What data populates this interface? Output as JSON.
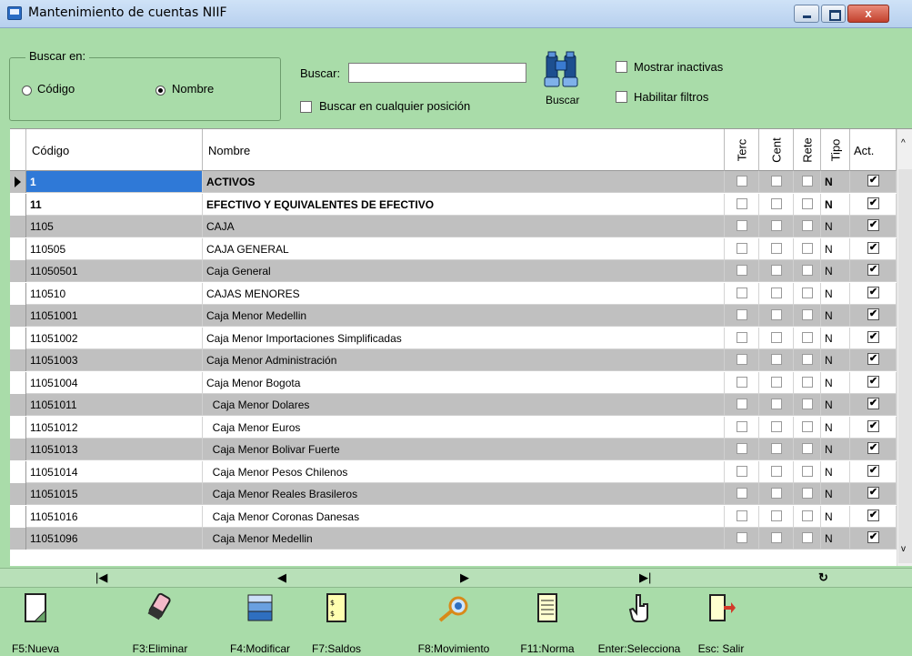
{
  "window": {
    "title": "Mantenimiento de cuentas NIIF",
    "close_label": "x"
  },
  "search": {
    "group_title": "Buscar en:",
    "radio_code": "Código",
    "radio_name": "Nombre",
    "selected": "Nombre",
    "label": "Buscar:",
    "value": "",
    "any_position_label": "Buscar en cualquier posición",
    "button_label": "Buscar",
    "show_inactive_label": "Mostrar inactivas",
    "enable_filters_label": "Habilitar filtros"
  },
  "grid": {
    "columns": {
      "code": "Código",
      "name": "Nombre",
      "terc": "Terc",
      "cent": "Cent",
      "rete": "Rete",
      "tipo": "Tipo",
      "act": "Act."
    },
    "rows": [
      {
        "code": "1",
        "name": "ACTIVOS",
        "tipo": "N",
        "act": true,
        "bold": true
      },
      {
        "code": "11",
        "name": "EFECTIVO Y EQUIVALENTES DE EFECTIVO",
        "tipo": "N",
        "act": true,
        "bold": true
      },
      {
        "code": "1105",
        "name": "CAJA",
        "tipo": "N",
        "act": true
      },
      {
        "code": "110505",
        "name": "CAJA GENERAL",
        "tipo": "N",
        "act": true
      },
      {
        "code": "11050501",
        "name": "Caja General",
        "tipo": "N",
        "act": true
      },
      {
        "code": "110510",
        "name": "CAJAS MENORES",
        "tipo": "N",
        "act": true
      },
      {
        "code": "11051001",
        "name": "Caja Menor Medellin",
        "tipo": "N",
        "act": true
      },
      {
        "code": "11051002",
        "name": "Caja Menor Importaciones Simplificadas",
        "tipo": "N",
        "act": true
      },
      {
        "code": "11051003",
        "name": "Caja Menor Administración",
        "tipo": "N",
        "act": true
      },
      {
        "code": "11051004",
        "name": "Caja Menor Bogota",
        "tipo": "N",
        "act": true
      },
      {
        "code": "11051011",
        "name": "  Caja Menor Dolares",
        "tipo": "N",
        "act": true
      },
      {
        "code": "11051012",
        "name": "  Caja Menor Euros",
        "tipo": "N",
        "act": true
      },
      {
        "code": "11051013",
        "name": "  Caja Menor Bolivar Fuerte",
        "tipo": "N",
        "act": true
      },
      {
        "code": "11051014",
        "name": "  Caja Menor Pesos Chilenos",
        "tipo": "N",
        "act": true
      },
      {
        "code": "11051015",
        "name": "  Caja Menor Reales Brasileros",
        "tipo": "N",
        "act": true
      },
      {
        "code": "11051016",
        "name": "  Caja Menor Coronas Danesas",
        "tipo": "N",
        "act": true
      },
      {
        "code": "11051096",
        "name": "  Caja Menor Medellin",
        "tipo": "N",
        "act": true
      }
    ]
  },
  "nav": {
    "first": "|◀",
    "prev": "◀",
    "next": "▶",
    "last": "▶|",
    "refresh": "↻"
  },
  "footer": [
    {
      "name": "f5-nueva-button",
      "label": "F5:Nueva",
      "icon": "new-document-icon"
    },
    {
      "name": "f3-eliminar-button",
      "label": "F3:Eliminar",
      "icon": "eraser-icon"
    },
    {
      "name": "f4-modificar-button",
      "label": "F4:Modificar",
      "icon": "edit-stack-icon"
    },
    {
      "name": "f7-saldos-button",
      "label": "F7:Saldos",
      "icon": "balance-sheet-icon"
    },
    {
      "name": "f8-movimiento-button",
      "label": "F8:Movimiento",
      "icon": "magnifier-gear-icon"
    },
    {
      "name": "f11-norma-button",
      "label": "F11:Norma",
      "icon": "ledger-icon"
    },
    {
      "name": "enter-selecciona-button",
      "label": "Enter:Selecciona",
      "icon": "pointer-hand-icon"
    },
    {
      "name": "esc-salir-button",
      "label": "Esc: Salir",
      "icon": "exit-door-icon"
    }
  ]
}
